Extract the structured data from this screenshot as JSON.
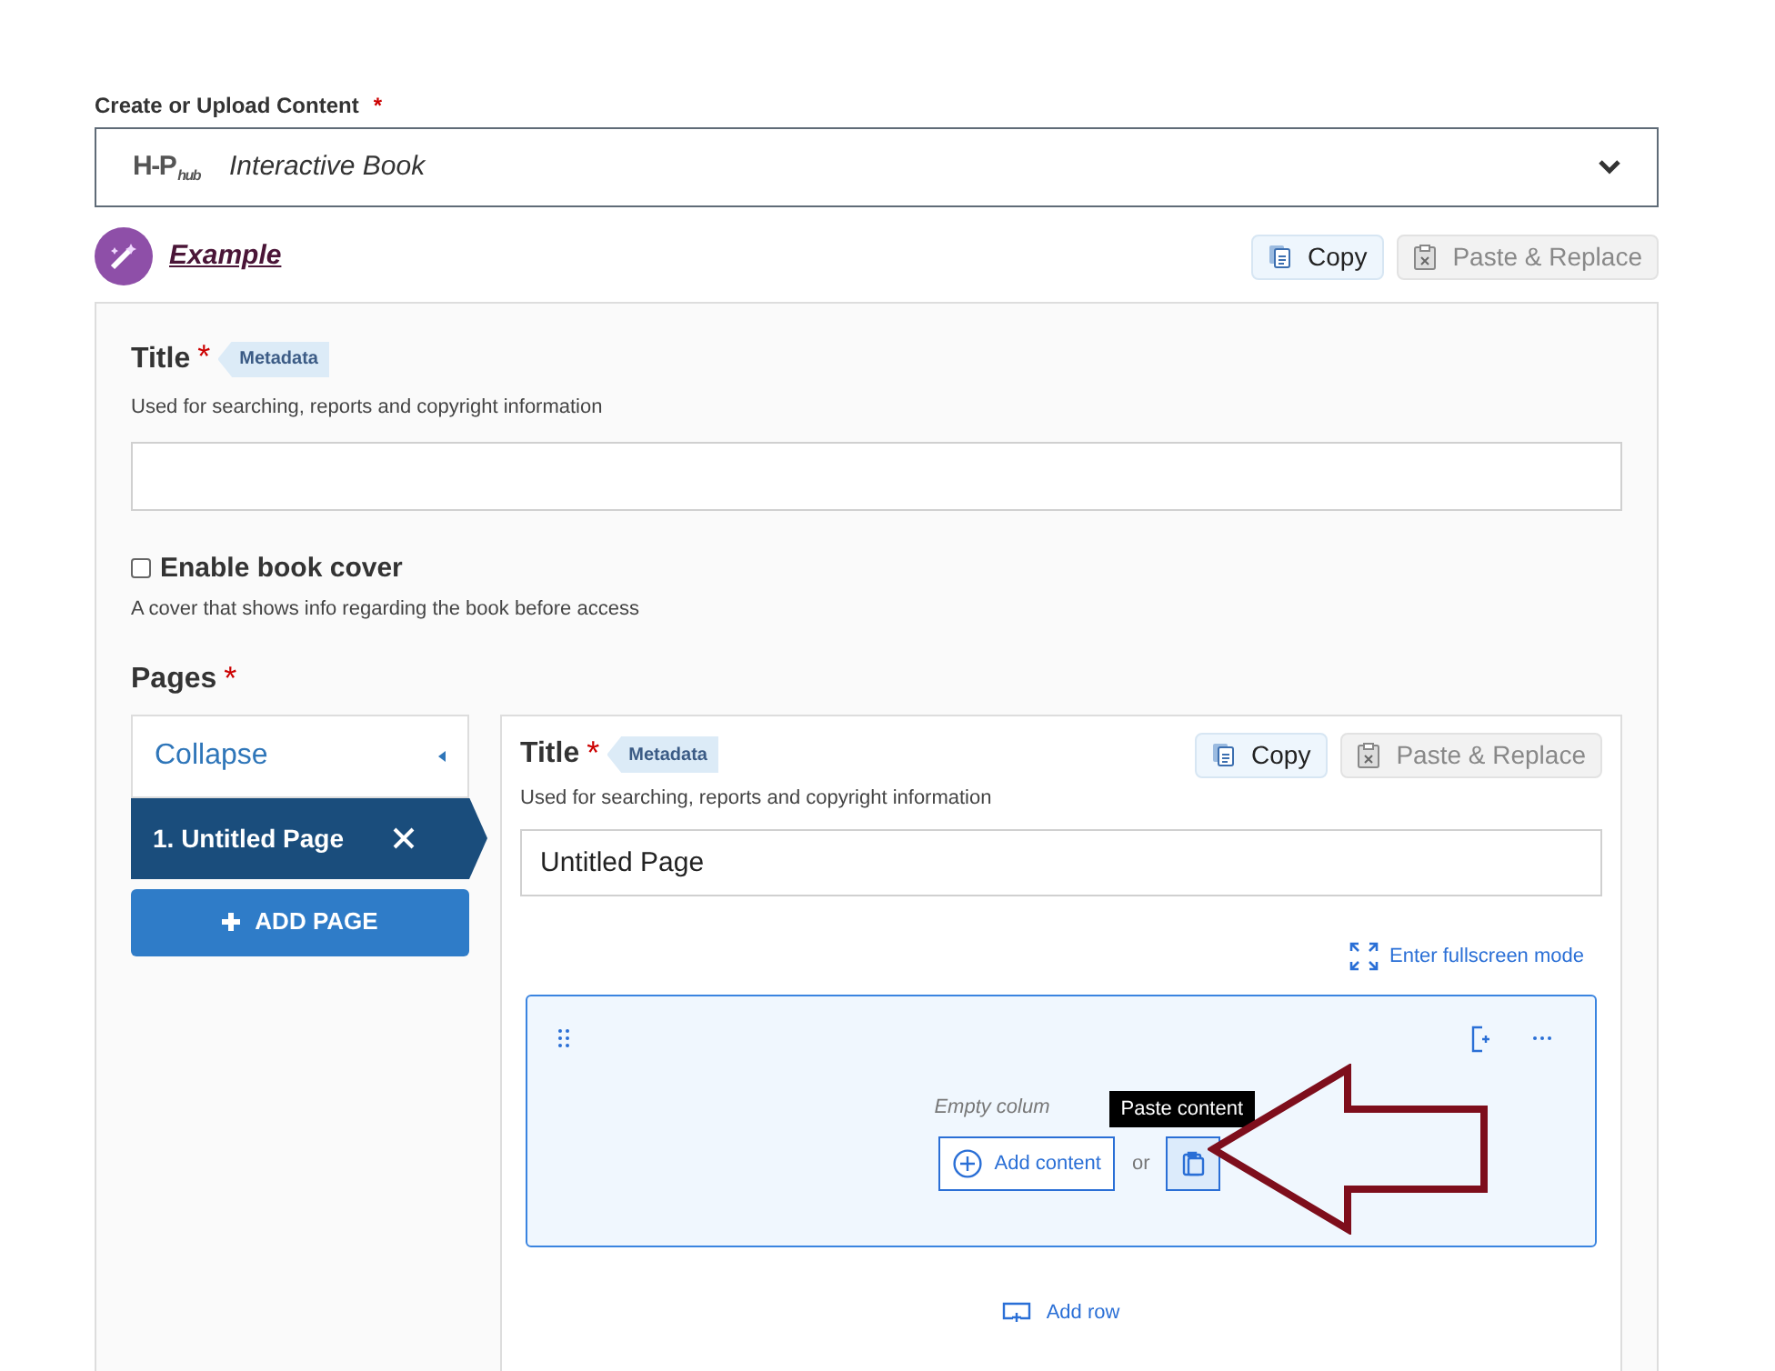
{
  "content_field": {
    "label": "Create or Upload Content",
    "required": "*",
    "selector": {
      "logo": "H-P",
      "logo_sub": "hub",
      "value": "Interactive Book"
    }
  },
  "example_link": "Example",
  "top_actions": [
    {
      "kind": "copy",
      "label": "Copy"
    },
    {
      "kind": "paste",
      "label": "Paste & Replace"
    }
  ],
  "title_field": {
    "label": "Title",
    "required": "*",
    "badge": "Metadata",
    "description": "Used for searching, reports and copyright information"
  },
  "book_cover": {
    "label": "Enable book cover",
    "checked": false,
    "description": "A cover that shows info regarding the book before access"
  },
  "pages": {
    "label": "Pages",
    "required": "*",
    "collapse": "Collapse",
    "items": [
      {
        "label": "1. Untitled Page",
        "selected": true
      }
    ],
    "add_button": "ADD PAGE",
    "editor": {
      "title_label": "Title",
      "required": "*",
      "badge": "Metadata",
      "description": "Used for searching, reports and copyright information",
      "actions": [
        {
          "kind": "copy",
          "label": "Copy"
        },
        {
          "kind": "paste",
          "label": "Paste & Replace"
        }
      ],
      "title_value": "Untitled Page",
      "fullscreen_link": "Enter fullscreen mode",
      "row": {
        "empty_text": "Empty colum",
        "add_content": "Add content",
        "or": "or",
        "tooltip": "Paste content"
      },
      "add_row": "Add row"
    }
  }
}
